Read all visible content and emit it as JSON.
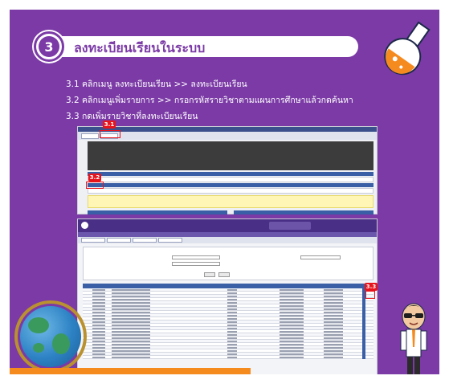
{
  "slide": {
    "step_number": "3",
    "title": "ลงทะเบียนเรียนในระบบ",
    "instructions": [
      "3.1 คลิกเมนู ลงทะเบียนเรียน >> ลงทะเบียนเรียน",
      "3.2 คลิกเมนูเพิ่มรายการ >> กรอกรหัสรายวิชาตามแผนการศึกษาแล้วกดค้นหา",
      "3.3 กดเพิ่มรายวิชาที่ลงทะเบียนเรียน"
    ],
    "callouts": {
      "c1": "3.1",
      "c2": "3.2",
      "c3": "3.3"
    }
  },
  "colors": {
    "background": "#7b3aa6",
    "accent_orange": "#f58a1f",
    "callout_red": "#e8141c"
  },
  "icons": [
    "flask-icon",
    "globe-icon",
    "student-character-icon"
  ]
}
